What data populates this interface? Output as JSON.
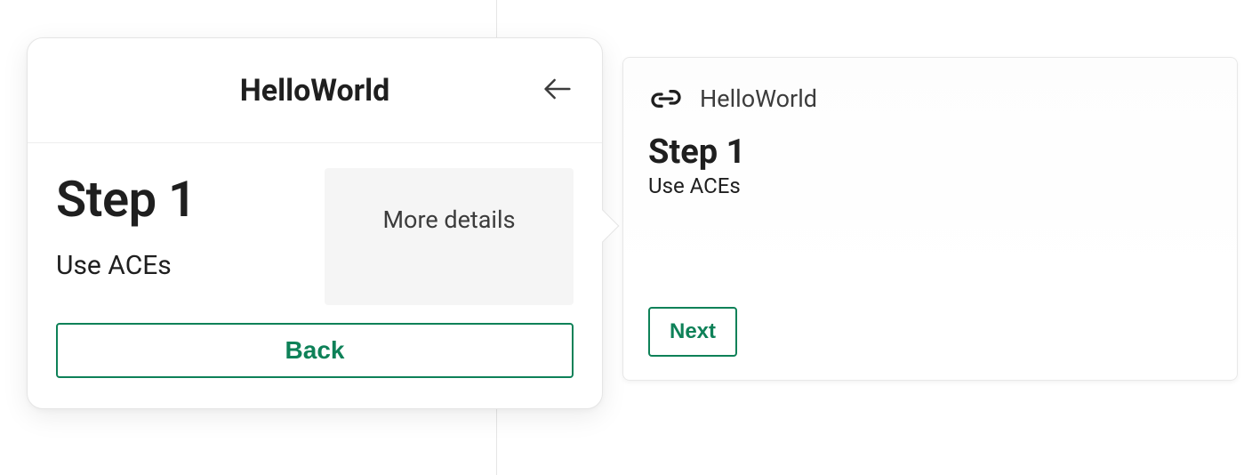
{
  "popover": {
    "title": "HelloWorld",
    "step_title": "Step 1",
    "step_subtitle": "Use ACEs",
    "more_details_label": "More details",
    "back_label": "Back"
  },
  "card": {
    "app_name": "HelloWorld",
    "step_title": "Step 1",
    "step_subtitle": "Use ACEs",
    "next_label": "Next"
  },
  "colors": {
    "accent": "#0e8158"
  }
}
